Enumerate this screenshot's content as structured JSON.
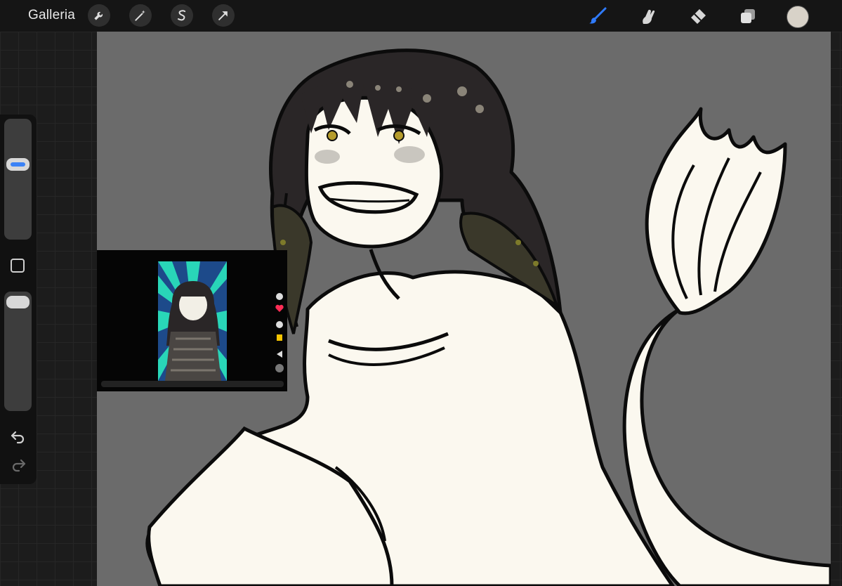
{
  "toolbar": {
    "gallery_label": "Galleria",
    "left_tools": [
      {
        "name": "actions-wrench-icon"
      },
      {
        "name": "adjustments-wand-icon"
      },
      {
        "name": "selection-s-icon"
      },
      {
        "name": "transform-arrow-icon"
      }
    ],
    "right_tools": [
      {
        "name": "brush-icon",
        "active": true,
        "color": "#2f7bff"
      },
      {
        "name": "smudge-icon"
      },
      {
        "name": "eraser-icon"
      },
      {
        "name": "layers-icon"
      }
    ],
    "current_color": "#d8d2c8"
  },
  "sidebar": {
    "brush_size_level": 0.35,
    "opacity_level": 0.0,
    "accent_color": "#3b82f6"
  },
  "canvas": {
    "background_color": "#6b6b6b",
    "fill_color": "#fbf8ef",
    "line_color": "#0b0b0b",
    "hair_color": "#2a2627"
  },
  "reference_image": {
    "visible": true
  }
}
